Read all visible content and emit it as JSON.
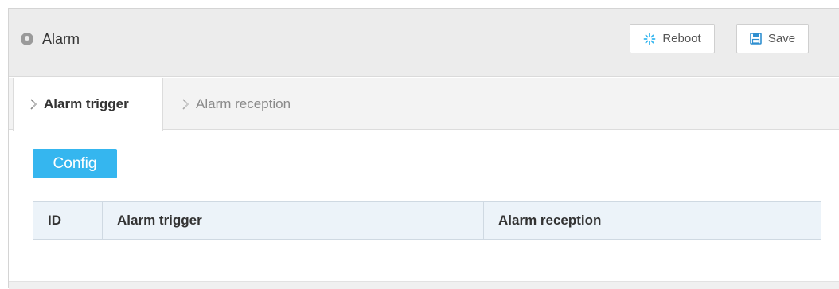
{
  "header": {
    "title": "Alarm",
    "icon": "location-pin-icon",
    "reboot_label": "Reboot",
    "save_label": "Save"
  },
  "tabs": [
    {
      "label": "Alarm trigger",
      "active": true
    },
    {
      "label": "Alarm reception",
      "active": false
    }
  ],
  "config_label": "Config",
  "table": {
    "columns": [
      "ID",
      "Alarm trigger",
      "Alarm reception"
    ],
    "rows": []
  },
  "colors": {
    "accent": "#35b6ef",
    "header_bg": "#ececec",
    "table_header_bg": "#ecf3f9"
  }
}
